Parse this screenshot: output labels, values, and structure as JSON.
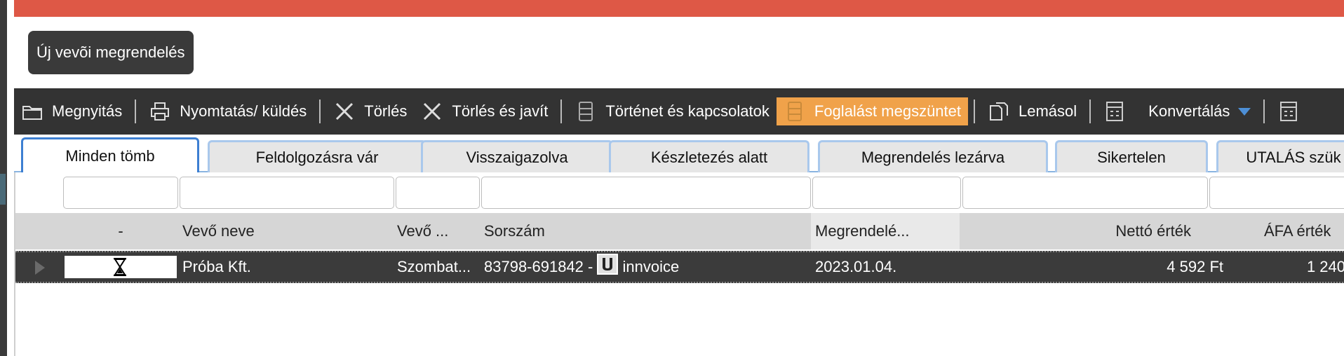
{
  "new_order_button": "Új vevõi megrendelés",
  "toolbar": [
    {
      "label": "Megnyitás",
      "icon": "folder-icon"
    },
    {
      "label": "Nyomtatás/ küldés",
      "icon": "printer-icon"
    },
    {
      "label": "Törlés",
      "icon": "delete-icon"
    },
    {
      "label": "Törlés és javít",
      "icon": "delete-fix-icon"
    },
    {
      "label": "Történet és kapcsolatok",
      "icon": "history-icon"
    },
    {
      "label": "Foglalást megszüntet",
      "icon": "cancel-reservation-icon",
      "highlighted": true
    },
    {
      "label": "Lemásol",
      "icon": "copy-icon"
    },
    {
      "label": "",
      "icon": "calculator-icon"
    },
    {
      "label": "Konvertálás",
      "icon": "dropdown-caret-icon"
    },
    {
      "label": "",
      "icon": "calculator-icon"
    }
  ],
  "tabs": [
    {
      "label": "Minden tömb",
      "active": true
    },
    {
      "label": "Feldolgozásra vár"
    },
    {
      "label": "Visszaigazolva"
    },
    {
      "label": "Készletezés alatt"
    },
    {
      "label": "Megrendelés lezárva"
    },
    {
      "label": "Sikertelen"
    },
    {
      "label": "UTALÁS szük"
    }
  ],
  "columns": {
    "status": "-",
    "customer_name": "Vevő neve",
    "customer_extra": "Vevő ...",
    "serial": "Sorszám",
    "order_date": "Megrendelé...",
    "net_value": "Nettó érték",
    "vat_value": "ÁFA érték"
  },
  "rows": [
    {
      "status_icon": "hourglass-icon",
      "customer_name": "Próba Kft.",
      "customer_extra": "Szombat...",
      "serial_number": "83798-691842 -",
      "serial_logo": "innvoice-logo-icon",
      "serial_suffix": "innvoice",
      "order_date": "2023.01.04.",
      "net_value": "4 592 Ft",
      "vat_value": "1 240"
    }
  ],
  "colors": {
    "top_bar": "#de5846",
    "toolbar_bg": "#333333",
    "highlight": "#f0a24a",
    "tab_border": "#a9c8ec",
    "tab_active_border": "#3d7fd2",
    "row_bg": "#3b3b3b"
  }
}
